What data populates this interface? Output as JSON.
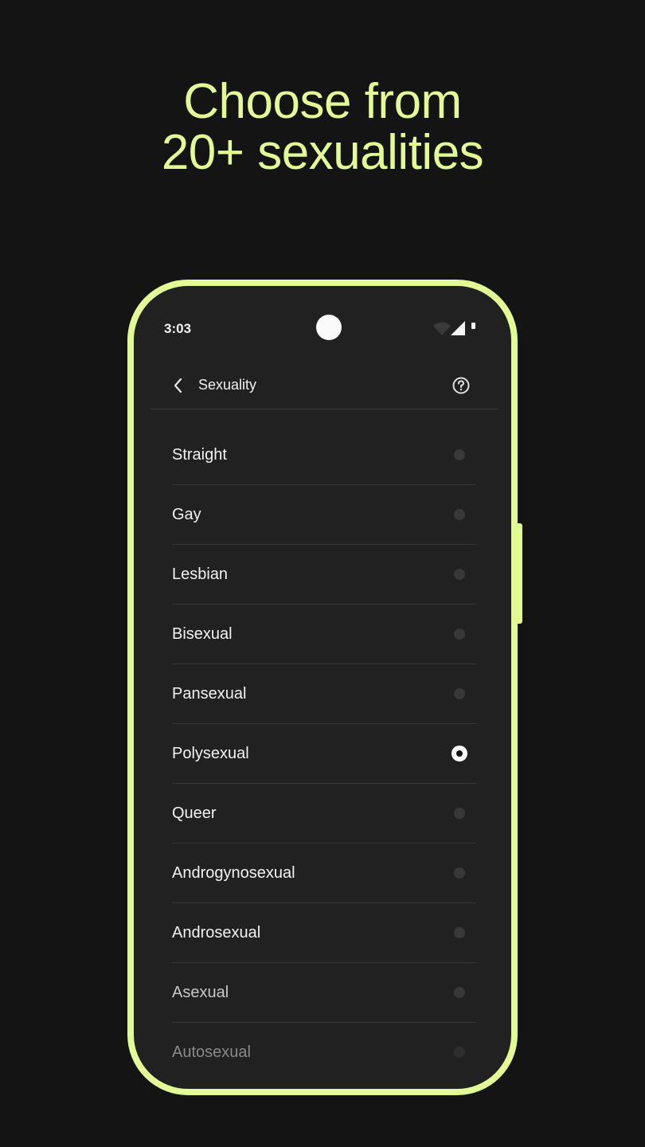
{
  "headline": {
    "line1": "Choose from",
    "line2": "20+ sexualities"
  },
  "colors": {
    "accent": "#e3fb95",
    "background": "#141414",
    "screen": "#212121"
  },
  "status_bar": {
    "time": "3:03",
    "icons": [
      "wifi-icon",
      "signal-icon",
      "battery-icon"
    ]
  },
  "toolbar": {
    "title": "Sexuality",
    "back_icon": "chevron-left-icon",
    "help_icon": "help-circle-icon"
  },
  "options": [
    {
      "label": "Straight",
      "selected": false
    },
    {
      "label": "Gay",
      "selected": false
    },
    {
      "label": "Lesbian",
      "selected": false
    },
    {
      "label": "Bisexual",
      "selected": false
    },
    {
      "label": "Pansexual",
      "selected": false
    },
    {
      "label": "Polysexual",
      "selected": true
    },
    {
      "label": "Queer",
      "selected": false
    },
    {
      "label": "Androgynosexual",
      "selected": false
    },
    {
      "label": "Androsexual",
      "selected": false
    },
    {
      "label": "Asexual",
      "selected": false
    },
    {
      "label": "Autosexual",
      "selected": false
    }
  ]
}
